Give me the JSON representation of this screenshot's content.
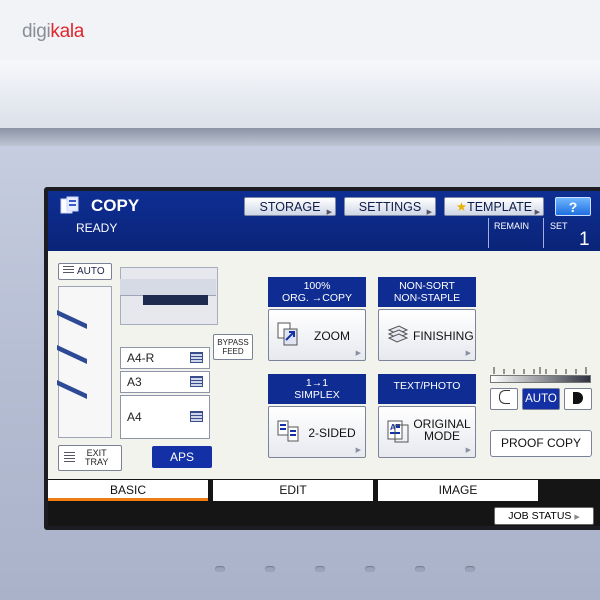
{
  "brand": {
    "logo_text_1": "digi",
    "logo_text_2": "kala"
  },
  "header": {
    "title": "COPY",
    "buttons": {
      "storage": "STORAGE",
      "settings": "SETTINGS",
      "template": "TEMPLATE",
      "help": "?"
    },
    "status": "READY",
    "remain_label": "REMAIN",
    "set_label": "SET",
    "set_value": "1"
  },
  "machine": {
    "auto_label": "AUTO",
    "drawers": [
      "A4-R",
      "A3",
      "A4"
    ],
    "bypass": [
      "BYPASS",
      "FEED"
    ],
    "exit_tray": [
      "EXIT",
      "TRAY"
    ],
    "aps_label": "APS"
  },
  "functions": {
    "zoom": {
      "head_1": "100%",
      "head_2": "ORG. →COPY",
      "label": "ZOOM"
    },
    "finishing": {
      "head_1": "NON-SORT",
      "head_2": "NON-STAPLE",
      "label": "FINISHING"
    },
    "sided": {
      "head_1": "1→1",
      "head_2": "SIMPLEX",
      "label": "2-SIDED"
    },
    "original": {
      "head_1": "TEXT/PHOTO",
      "label_1": "ORIGINAL",
      "label_2": "MODE"
    }
  },
  "density": {
    "auto_label": "AUTO",
    "proof_copy": "PROOF COPY"
  },
  "tabs": [
    "BASIC",
    "EDIT",
    "IMAGE"
  ],
  "job_status": "JOB STATUS",
  "colors": {
    "accent_blue": "#0f2c92",
    "active_tab": "#f07d14",
    "help_blue": "#1f6fe0"
  }
}
